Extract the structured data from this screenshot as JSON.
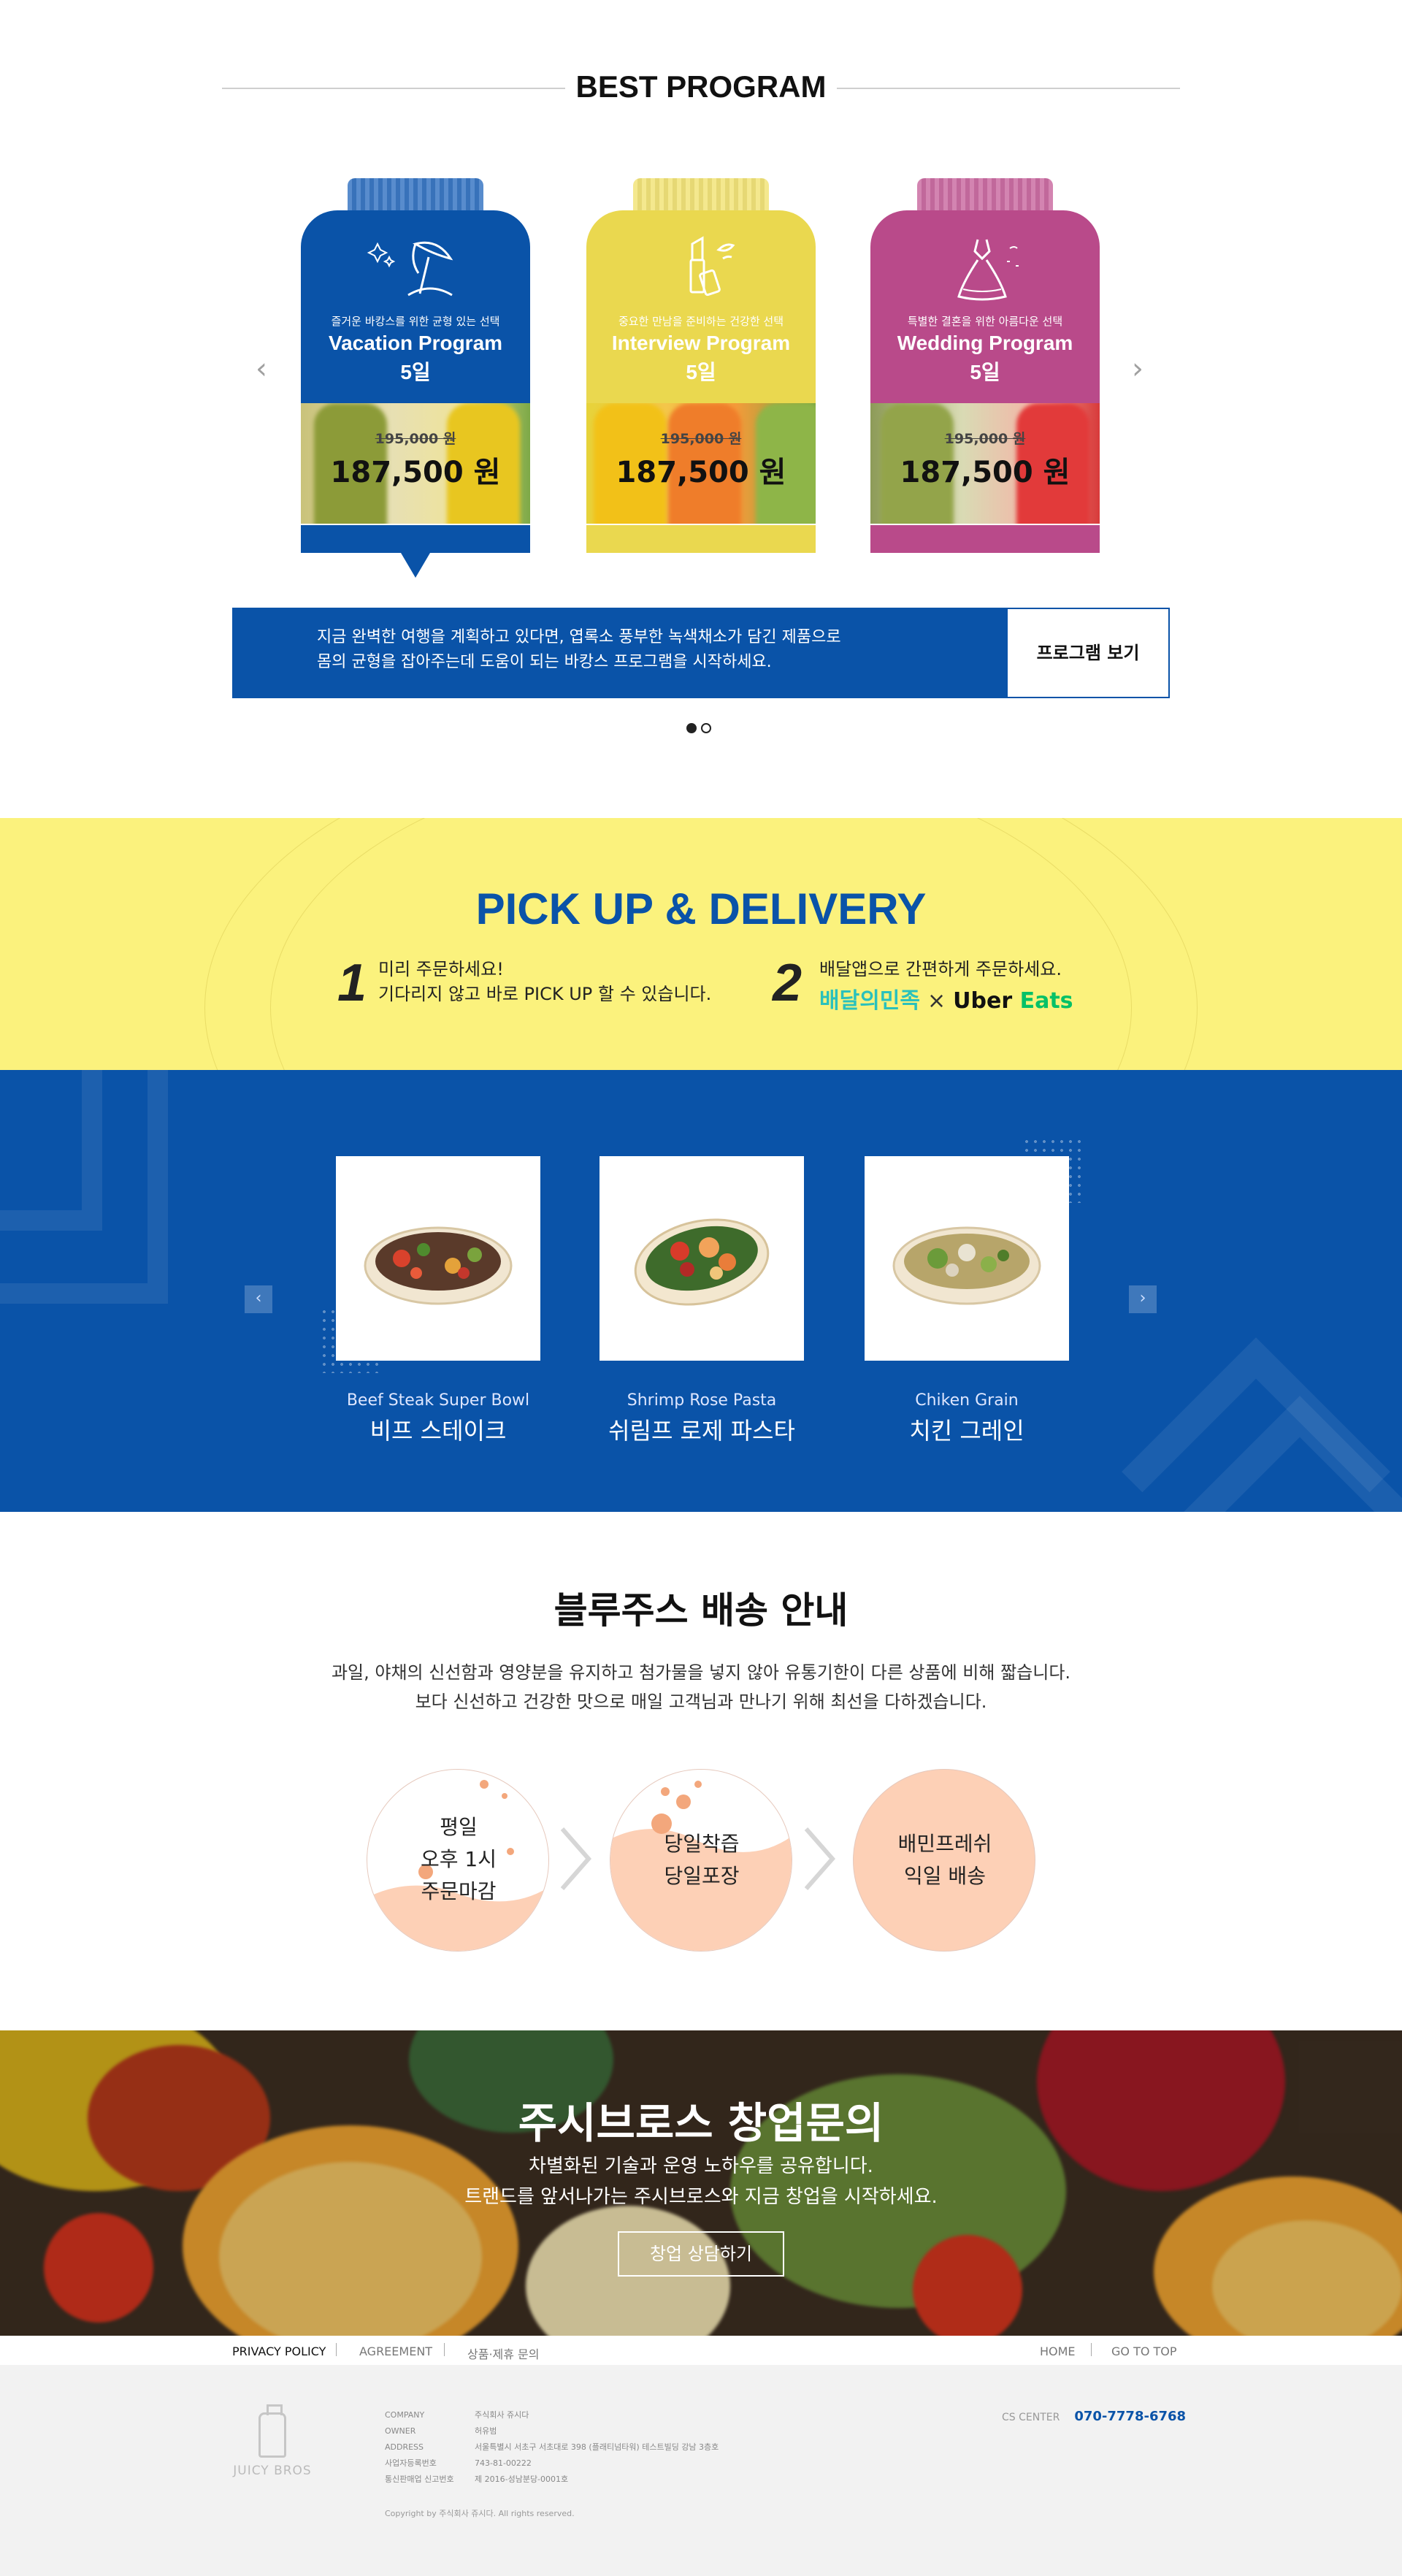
{
  "best_program": {
    "title": "BEST PROGRAM",
    "cards": [
      {
        "tagline": "즐거운 바캉스를 위한 균형 있는 선택",
        "name": "Vacation Program",
        "days": "5일",
        "old_price": "195,000 원",
        "price": "187,500 원",
        "color": "#0a53a8",
        "icon": "beach-umbrella-icon"
      },
      {
        "tagline": "중요한 만남을 준비하는 건강한 선택",
        "name": "Interview Program",
        "days": "5일",
        "old_price": "195,000 원",
        "price": "187,500 원",
        "color": "#ead84f",
        "icon": "lipstick-icon"
      },
      {
        "tagline": "특별한 결혼을 위한 아름다운 선택",
        "name": "Wedding Program",
        "days": "5일",
        "old_price": "195,000 원",
        "price": "187,500 원",
        "color": "#b94a8a",
        "icon": "wedding-dress-icon"
      }
    ],
    "description_line1": "지금 완벽한 여행을 계획하고 있다면, 엽록소 풍부한 녹색채소가 담긴 제품으로",
    "description_line2": "몸의 균형을 잡아주는데 도움이 되는 바캉스 프로그램을 시작하세요.",
    "button": "프로그램 보기",
    "prev_arrow": "‹",
    "next_arrow": "›"
  },
  "pickup": {
    "title": "PICK UP & DELIVERY",
    "step1_num": "1",
    "step1_line1": "미리 주문하세요!",
    "step1_line2": "기다리지 않고 바로 PICK UP 할 수 있습니다.",
    "step2_num": "2",
    "step2_line1": "배달앱으로 간편하게 주문하세요.",
    "brand1": "배달의민족",
    "brand_sep": "×",
    "brand2a": "Uber",
    "brand2b": "Eats"
  },
  "menu": {
    "prev_arrow": "‹",
    "next_arrow": "›",
    "items": [
      {
        "en": "Beef Steak Super Bowl",
        "ko": "비프 스테이크"
      },
      {
        "en": "Shrimp Rose Pasta",
        "ko": "쉬림프 로제 파스타"
      },
      {
        "en": "Chiken Grain",
        "ko": "치킨 그레인"
      }
    ]
  },
  "delivery_info": {
    "title": "블루주스 배송 안내",
    "line1": "과일, 야채의 신선함과 영양분을 유지하고 첨가물을 넣지 않아 유통기한이 다른 상품에 비해 짧습니다.",
    "line2": "보다 신선하고 건강한 맛으로 매일 고객님과 만나기 위해 최선을 다하겠습니다.",
    "steps": [
      {
        "line1": "평일",
        "line2": "오후 1시",
        "line3": "주문마감"
      },
      {
        "line1": "당일착즙",
        "line2": "당일포장"
      },
      {
        "line1": "배민프레쉬",
        "line2": "익일 배송"
      }
    ]
  },
  "franchise": {
    "title": "주시브로스 창업문의",
    "line1": "차별화된 기술과 운영 노하우를 공유합니다.",
    "line2": "트랜드를 앞서나가는 주시브로스와 지금 창업을 시작하세요.",
    "button": "창업 상담하기"
  },
  "footer": {
    "links": [
      "PRIVACY POLICY",
      "AGREEMENT",
      "상품·제휴 문의"
    ],
    "right_links": [
      "HOME",
      "GO TO TOP"
    ],
    "logo": "JUICY BROS",
    "info": [
      {
        "k": "COMPANY",
        "v": "주식회사 쥬시다"
      },
      {
        "k": "OWNER",
        "v": "허유범"
      },
      {
        "k": "ADDRESS",
        "v": "서울특별시 서초구 서초대로 398 (플래티넘타워) 테스트빌딩 강남 3층호"
      },
      {
        "k": "사업자등록번호",
        "v": "743-81-00222"
      },
      {
        "k": "통신판매업 신고번호",
        "v": "제 2016-성남분당-0001호"
      }
    ],
    "copyright": "Copyright by 주식회사 쥬시다. All rights reserved.",
    "cs_label": "CS CENTER",
    "cs_phone": "070-7778-6768"
  }
}
